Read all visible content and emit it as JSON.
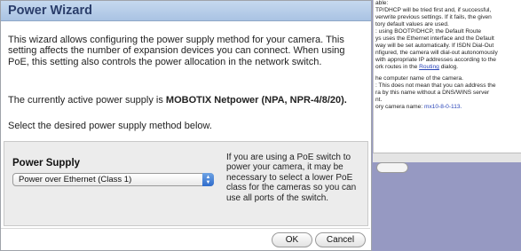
{
  "background_help": {
    "lines_top": [
      "able:",
      "TP/DHCP will be tried first and, if successful,",
      "verwrite previous settings. If it fails, the given",
      "tory default values are used.",
      ": using BOOTP/DHCP, the Default Route",
      "ys uses the Ethernet interface and the Default",
      "way will be set automatically. If ISDN Dial-Out",
      "nfigured, the camera will dial-out autonomously",
      "with appropriate IP addresses according to the"
    ],
    "routing_prefix": "ork routes in the ",
    "routing_link": "Routing",
    "routing_suffix": " dialog.",
    "lines_bottom": [
      "he computer name of the camera.",
      ": This does not mean that you can address the",
      "ra by this name without a DNS/WINS server",
      "nt."
    ],
    "camera_name_prefix": "ory camera name: ",
    "camera_name_value": "mx10-8-0-113."
  },
  "wizard": {
    "title": "Power Wizard",
    "intro": "This wizard allows configuring the power supply method for your camera. This setting affects the number of expansion devices you can connect. When using PoE, this setting also controls the power allocation in the network switch.",
    "active_prefix": "The currently active power supply is ",
    "active_value": "MOBOTIX Netpower (NPA, NPR-4/8/20).",
    "select_prompt": "Select the desired power supply method below.",
    "power_supply_label": "Power Supply",
    "power_supply_selected": "Power over Ethernet (Class 1)",
    "power_supply_note": "If you are using a PoE switch to power your camera, it may be necessary to select a lower PoE class for the cameras so you can use all ports of the switch.",
    "ok_label": "OK",
    "cancel_label": "Cancel"
  },
  "colors": {
    "titlebar": "#b7cde9",
    "title_text": "#2a3d6a",
    "link": "#2a45b8",
    "background": "#9699c2"
  }
}
